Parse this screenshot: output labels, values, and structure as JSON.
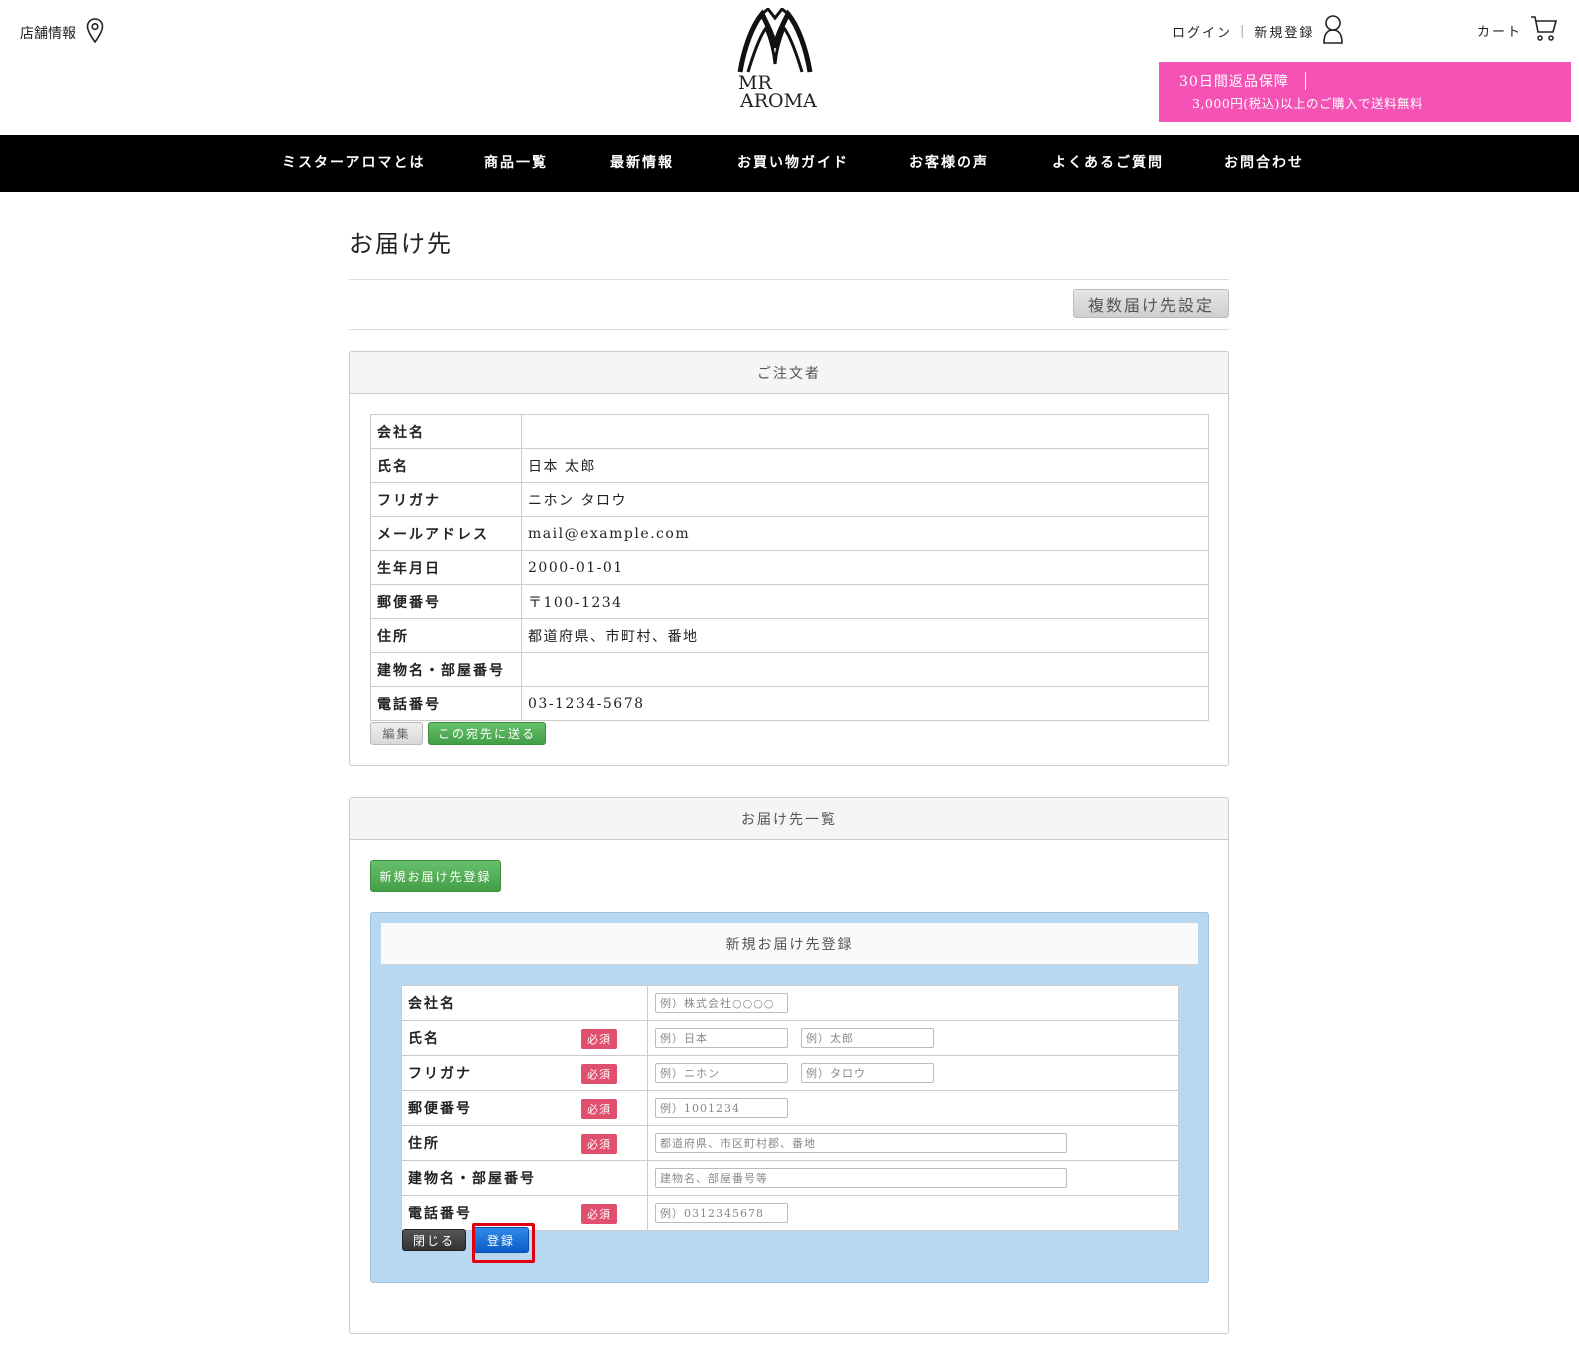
{
  "header": {
    "store_info": "店舗情報",
    "logo_line1": "MR",
    "logo_line2": "AROMA",
    "login": "ログイン",
    "register": "新規登録",
    "cart": "カート",
    "promo_line1": "30日間返品保障",
    "promo_line2": "3,000円(税込)以上のご購入で送料無料",
    "promo_color": "#f552b5"
  },
  "nav": {
    "items": [
      "ミスターアロマとは",
      "商品一覧",
      "最新情報",
      "お買い物ガイド",
      "お客様の声",
      "よくあるご質問",
      "お問合わせ"
    ]
  },
  "page": {
    "title": "お届け先",
    "multi_button": "複数届け先設定"
  },
  "orderer": {
    "heading": "ご注文者",
    "rows": [
      {
        "label": "会社名",
        "value": ""
      },
      {
        "label": "氏名",
        "value": "日本 太郎"
      },
      {
        "label": "フリガナ",
        "value": "ニホン タロウ"
      },
      {
        "label": "メールアドレス",
        "value": "mail@example.com"
      },
      {
        "label": "生年月日",
        "value": "2000-01-01"
      },
      {
        "label": "郵便番号",
        "value": "〒100-1234"
      },
      {
        "label": "住所",
        "value": "都道府県、市町村、番地"
      },
      {
        "label": "建物名・部屋番号",
        "value": ""
      },
      {
        "label": "電話番号",
        "value": "03-1234-5678"
      }
    ],
    "edit_button": "編集",
    "send_button": "この宛先に送る"
  },
  "addresses": {
    "heading": "お届け先一覧",
    "new_button": "新規お届け先登録",
    "form": {
      "heading": "新規お届け先登録",
      "required": "必須",
      "labels": {
        "company": "会社名",
        "name": "氏名",
        "kana": "フリガナ",
        "zip": "郵便番号",
        "address": "住所",
        "building": "建物名・部屋番号",
        "phone": "電話番号"
      },
      "placeholders": {
        "company": "例）株式会社○○○○",
        "last_name": "例）日本",
        "first_name": "例）太郎",
        "last_kana": "例）ニホン",
        "first_kana": "例）タロウ",
        "zip": "例）1001234",
        "address": "都道府県、市区町村郡、番地",
        "building": "建物名、部屋番号等",
        "phone": "例）0312345678"
      },
      "close_button": "閉じる",
      "submit_button": "登録"
    }
  },
  "colors": {
    "nav_bg": "#000000",
    "form_bg": "#b7d8f0",
    "required_badge": "#e0506e",
    "highlight": "#e00012"
  }
}
